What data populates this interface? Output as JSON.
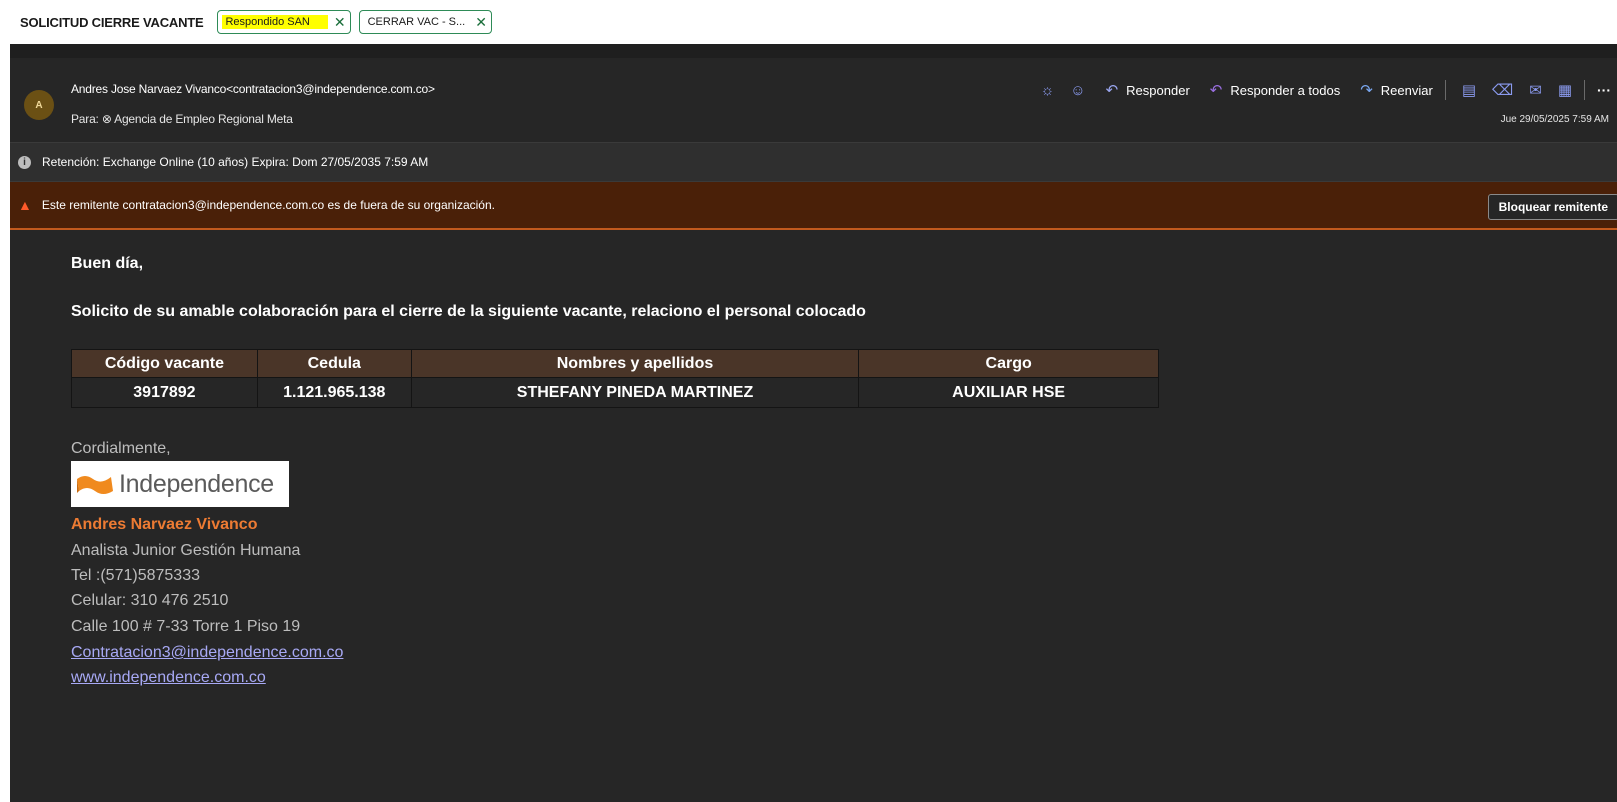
{
  "subject": {
    "title": "SOLICITUD CIERRE VACANTE",
    "tags": [
      {
        "label": "Respondido SAN",
        "close": "✕"
      },
      {
        "label": "CERRAR VAC - S...",
        "close": "✕"
      }
    ]
  },
  "header": {
    "avatar_initial": "A",
    "from": "Andres Jose Narvaez Vivanco<contratacion3@independence.com.co>",
    "to": "Para: ⊗ Agencia de Empleo Regional Meta",
    "date": "Jue 29/05/2025 7:59 AM",
    "toolbar": {
      "reply": "Responder",
      "reply_all": "Responder a todos",
      "forward": "Reenviar",
      "more": "···"
    }
  },
  "retention": {
    "text": "Retención: Exchange Online (10 años) Expira: Dom 27/05/2035 7:59 AM"
  },
  "warning": {
    "text": "Este remitente contratacion3@independence.com.co es de fuera de su organización.",
    "block_button": "Bloquear remitente"
  },
  "body": {
    "greeting": "Buen día,",
    "request": "Solicito de su amable colaboración para el cierre de la siguiente vacante, relaciono el personal colocado",
    "table": {
      "headers": [
        "Código vacante",
        "Cedula",
        "Nombres y apellidos",
        "Cargo"
      ],
      "rows": [
        [
          "3917892",
          "1.121.965.138",
          "STHEFANY PINEDA MARTINEZ",
          "AUXILIAR HSE"
        ]
      ]
    }
  },
  "signature": {
    "closing": "Cordialmente,",
    "logo_text": "Independence",
    "name": "Andres Narvaez Vivanco",
    "role": "Analista Junior Gestión Humana",
    "tel": "Tel :(571)5875333",
    "mobile": "Celular: 310 476 2510",
    "address": "Calle 100 # 7-33 Torre 1 Piso 19",
    "email": "Contratacion3@independence.com.co",
    "web": "www.independence.com.co"
  },
  "colors": {
    "accent_orange": "#ed7b33",
    "link": "#a8a9f5",
    "warning_bg": "#4a2008",
    "table_header": "#4a3528"
  }
}
